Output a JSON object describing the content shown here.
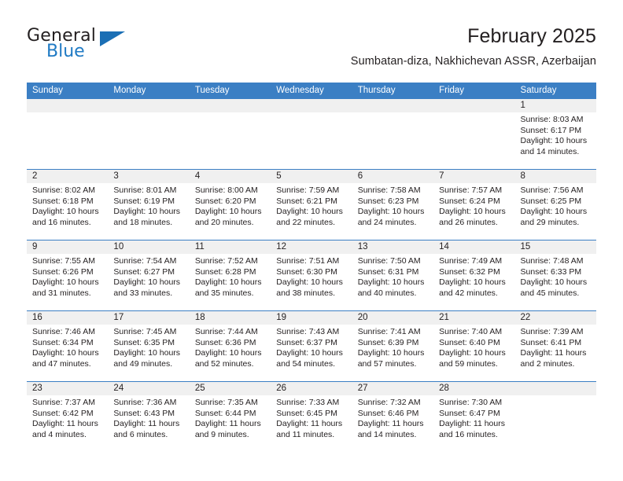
{
  "brand": {
    "word_general": "General",
    "word_blue": "Blue"
  },
  "header": {
    "title": "February 2025",
    "subtitle": "Sumbatan-diza, Nakhichevan ASSR, Azerbaijan"
  },
  "colors": {
    "header_blue": "#3b7fc4",
    "logo_blue": "#1f7ac4",
    "daynum_bg": "#f0f0f0",
    "text": "#231f20"
  },
  "weekdays": [
    "Sunday",
    "Monday",
    "Tuesday",
    "Wednesday",
    "Thursday",
    "Friday",
    "Saturday"
  ],
  "weeks": [
    [
      {
        "day": "",
        "sunrise": "",
        "sunset": "",
        "daylight": "",
        "empty": true
      },
      {
        "day": "",
        "sunrise": "",
        "sunset": "",
        "daylight": "",
        "empty": true
      },
      {
        "day": "",
        "sunrise": "",
        "sunset": "",
        "daylight": "",
        "empty": true
      },
      {
        "day": "",
        "sunrise": "",
        "sunset": "",
        "daylight": "",
        "empty": true
      },
      {
        "day": "",
        "sunrise": "",
        "sunset": "",
        "daylight": "",
        "empty": true
      },
      {
        "day": "",
        "sunrise": "",
        "sunset": "",
        "daylight": "",
        "empty": true
      },
      {
        "day": "1",
        "sunrise": "Sunrise: 8:03 AM",
        "sunset": "Sunset: 6:17 PM",
        "daylight": "Daylight: 10 hours and 14 minutes."
      }
    ],
    [
      {
        "day": "2",
        "sunrise": "Sunrise: 8:02 AM",
        "sunset": "Sunset: 6:18 PM",
        "daylight": "Daylight: 10 hours and 16 minutes."
      },
      {
        "day": "3",
        "sunrise": "Sunrise: 8:01 AM",
        "sunset": "Sunset: 6:19 PM",
        "daylight": "Daylight: 10 hours and 18 minutes."
      },
      {
        "day": "4",
        "sunrise": "Sunrise: 8:00 AM",
        "sunset": "Sunset: 6:20 PM",
        "daylight": "Daylight: 10 hours and 20 minutes."
      },
      {
        "day": "5",
        "sunrise": "Sunrise: 7:59 AM",
        "sunset": "Sunset: 6:21 PM",
        "daylight": "Daylight: 10 hours and 22 minutes."
      },
      {
        "day": "6",
        "sunrise": "Sunrise: 7:58 AM",
        "sunset": "Sunset: 6:23 PM",
        "daylight": "Daylight: 10 hours and 24 minutes."
      },
      {
        "day": "7",
        "sunrise": "Sunrise: 7:57 AM",
        "sunset": "Sunset: 6:24 PM",
        "daylight": "Daylight: 10 hours and 26 minutes."
      },
      {
        "day": "8",
        "sunrise": "Sunrise: 7:56 AM",
        "sunset": "Sunset: 6:25 PM",
        "daylight": "Daylight: 10 hours and 29 minutes."
      }
    ],
    [
      {
        "day": "9",
        "sunrise": "Sunrise: 7:55 AM",
        "sunset": "Sunset: 6:26 PM",
        "daylight": "Daylight: 10 hours and 31 minutes."
      },
      {
        "day": "10",
        "sunrise": "Sunrise: 7:54 AM",
        "sunset": "Sunset: 6:27 PM",
        "daylight": "Daylight: 10 hours and 33 minutes."
      },
      {
        "day": "11",
        "sunrise": "Sunrise: 7:52 AM",
        "sunset": "Sunset: 6:28 PM",
        "daylight": "Daylight: 10 hours and 35 minutes."
      },
      {
        "day": "12",
        "sunrise": "Sunrise: 7:51 AM",
        "sunset": "Sunset: 6:30 PM",
        "daylight": "Daylight: 10 hours and 38 minutes."
      },
      {
        "day": "13",
        "sunrise": "Sunrise: 7:50 AM",
        "sunset": "Sunset: 6:31 PM",
        "daylight": "Daylight: 10 hours and 40 minutes."
      },
      {
        "day": "14",
        "sunrise": "Sunrise: 7:49 AM",
        "sunset": "Sunset: 6:32 PM",
        "daylight": "Daylight: 10 hours and 42 minutes."
      },
      {
        "day": "15",
        "sunrise": "Sunrise: 7:48 AM",
        "sunset": "Sunset: 6:33 PM",
        "daylight": "Daylight: 10 hours and 45 minutes."
      }
    ],
    [
      {
        "day": "16",
        "sunrise": "Sunrise: 7:46 AM",
        "sunset": "Sunset: 6:34 PM",
        "daylight": "Daylight: 10 hours and 47 minutes."
      },
      {
        "day": "17",
        "sunrise": "Sunrise: 7:45 AM",
        "sunset": "Sunset: 6:35 PM",
        "daylight": "Daylight: 10 hours and 49 minutes."
      },
      {
        "day": "18",
        "sunrise": "Sunrise: 7:44 AM",
        "sunset": "Sunset: 6:36 PM",
        "daylight": "Daylight: 10 hours and 52 minutes."
      },
      {
        "day": "19",
        "sunrise": "Sunrise: 7:43 AM",
        "sunset": "Sunset: 6:37 PM",
        "daylight": "Daylight: 10 hours and 54 minutes."
      },
      {
        "day": "20",
        "sunrise": "Sunrise: 7:41 AM",
        "sunset": "Sunset: 6:39 PM",
        "daylight": "Daylight: 10 hours and 57 minutes."
      },
      {
        "day": "21",
        "sunrise": "Sunrise: 7:40 AM",
        "sunset": "Sunset: 6:40 PM",
        "daylight": "Daylight: 10 hours and 59 minutes."
      },
      {
        "day": "22",
        "sunrise": "Sunrise: 7:39 AM",
        "sunset": "Sunset: 6:41 PM",
        "daylight": "Daylight: 11 hours and 2 minutes."
      }
    ],
    [
      {
        "day": "23",
        "sunrise": "Sunrise: 7:37 AM",
        "sunset": "Sunset: 6:42 PM",
        "daylight": "Daylight: 11 hours and 4 minutes."
      },
      {
        "day": "24",
        "sunrise": "Sunrise: 7:36 AM",
        "sunset": "Sunset: 6:43 PM",
        "daylight": "Daylight: 11 hours and 6 minutes."
      },
      {
        "day": "25",
        "sunrise": "Sunrise: 7:35 AM",
        "sunset": "Sunset: 6:44 PM",
        "daylight": "Daylight: 11 hours and 9 minutes."
      },
      {
        "day": "26",
        "sunrise": "Sunrise: 7:33 AM",
        "sunset": "Sunset: 6:45 PM",
        "daylight": "Daylight: 11 hours and 11 minutes."
      },
      {
        "day": "27",
        "sunrise": "Sunrise: 7:32 AM",
        "sunset": "Sunset: 6:46 PM",
        "daylight": "Daylight: 11 hours and 14 minutes."
      },
      {
        "day": "28",
        "sunrise": "Sunrise: 7:30 AM",
        "sunset": "Sunset: 6:47 PM",
        "daylight": "Daylight: 11 hours and 16 minutes."
      },
      {
        "day": "",
        "sunrise": "",
        "sunset": "",
        "daylight": "",
        "empty": true
      }
    ]
  ]
}
